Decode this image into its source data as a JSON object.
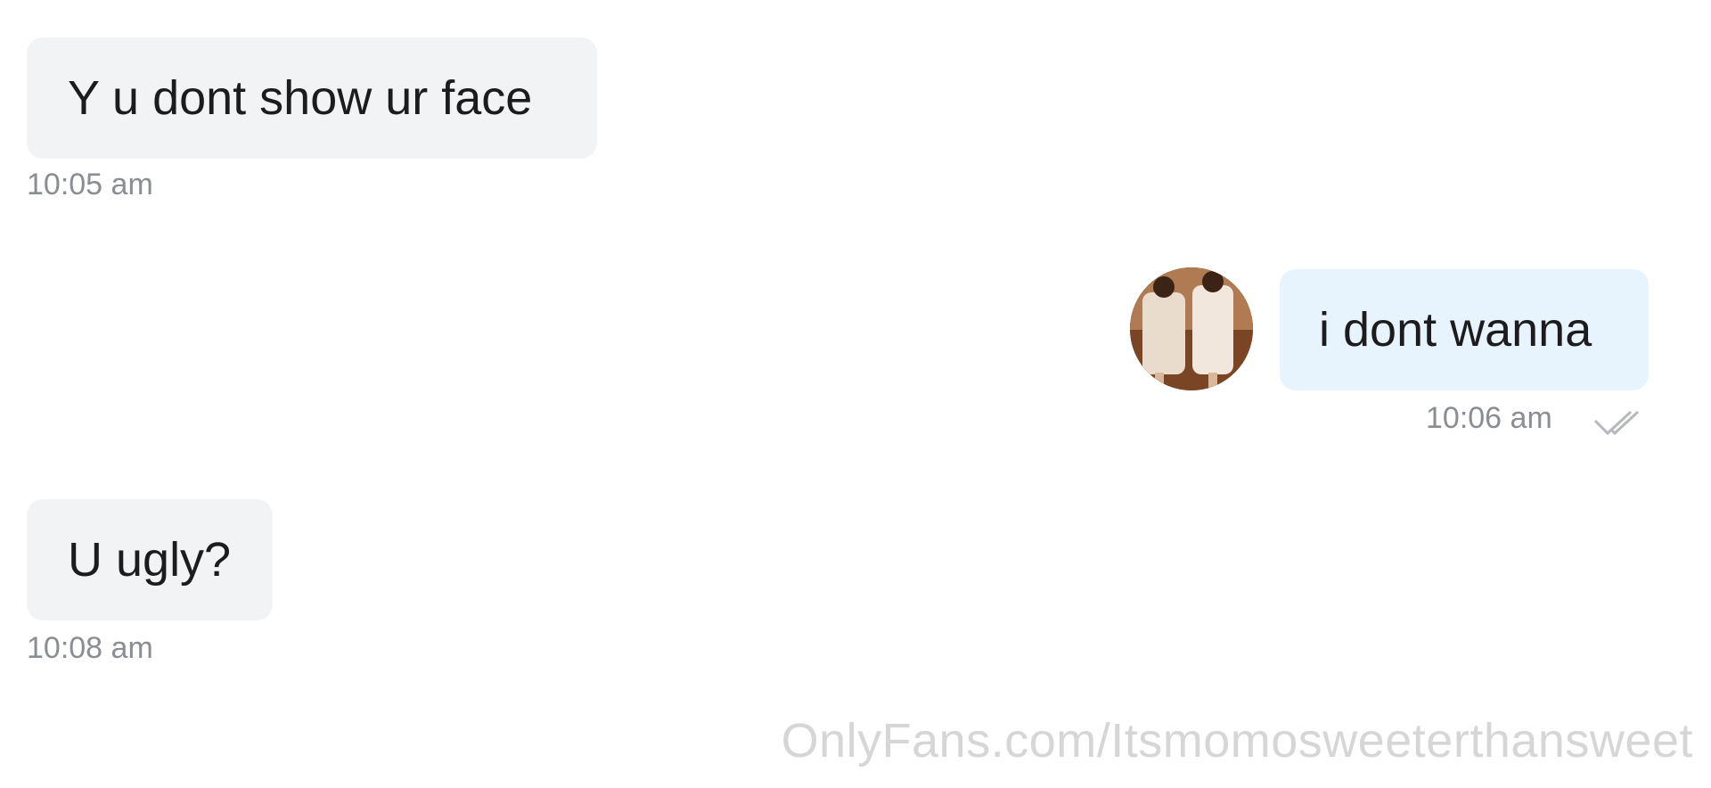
{
  "messages": [
    {
      "direction": "incoming",
      "text": "Y u dont show ur face",
      "time": "10:05 am"
    },
    {
      "direction": "outgoing",
      "text": "i dont wanna",
      "time": "10:06 am",
      "status_icon": "double-check-icon"
    },
    {
      "direction": "incoming",
      "text": "U ugly?",
      "time": "10:08 am"
    }
  ],
  "watermark": "OnlyFans.com/Itsmomosweeterthansweet",
  "colors": {
    "incoming_bubble": "#f2f3f5",
    "outgoing_bubble": "#e8f4fd",
    "timestamp": "#8a8d91",
    "watermark": "#d6d6d6"
  }
}
